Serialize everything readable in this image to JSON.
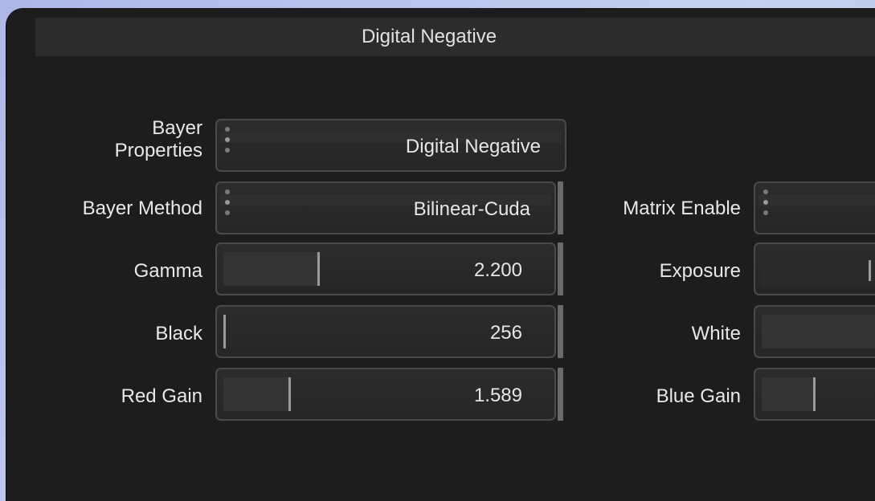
{
  "title": "Digital Negative",
  "rows": {
    "bayer_properties": {
      "label_line1": "Bayer",
      "label_line2": "Properties",
      "value": "Digital Negative"
    },
    "bayer_method": {
      "label": "Bayer Method",
      "value": "Bilinear-Cuda"
    },
    "matrix_enable": {
      "label": "Matrix Enable"
    },
    "gamma": {
      "label": "Gamma",
      "value": "2.200",
      "fill_fraction": 0.29
    },
    "exposure": {
      "label": "Exposure"
    },
    "black": {
      "label": "Black",
      "value": "256",
      "fill_fraction": 0.0
    },
    "white": {
      "label": "White"
    },
    "red_gain": {
      "label": "Red Gain",
      "value": "1.589",
      "fill_fraction": 0.2
    },
    "blue_gain": {
      "label": "Blue Gain"
    }
  }
}
